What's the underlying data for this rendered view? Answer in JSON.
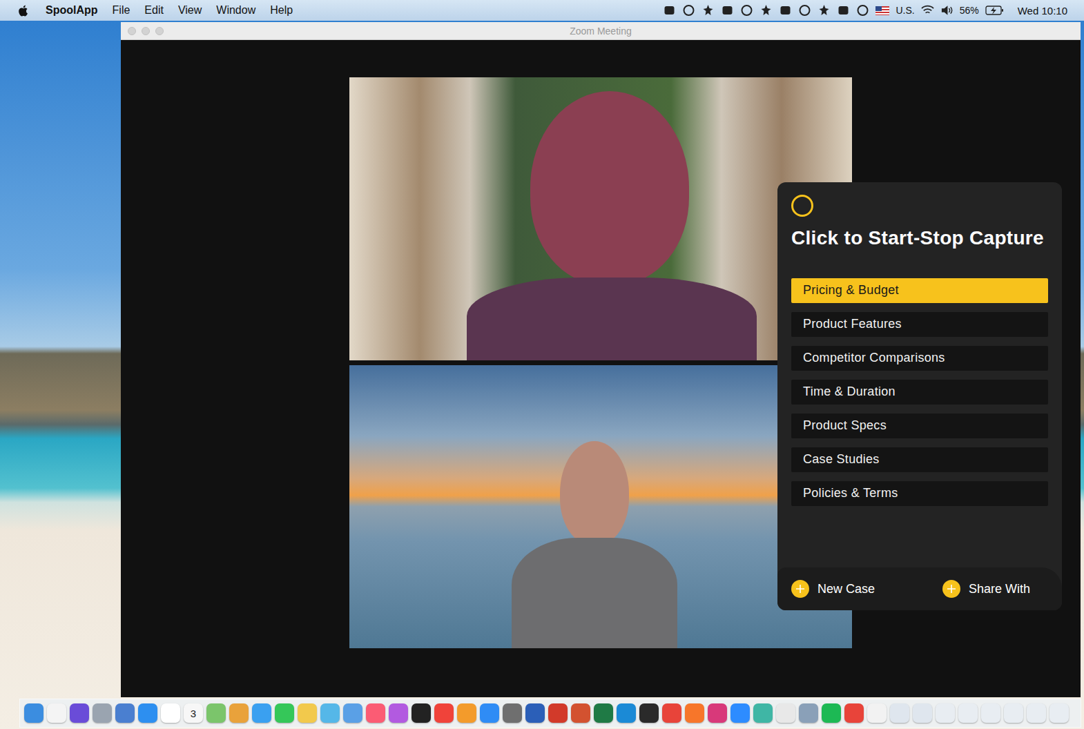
{
  "menubar": {
    "app": "SpoolApp",
    "menus": [
      "File",
      "Edit",
      "View",
      "Window",
      "Help"
    ],
    "input_source": "U.S.",
    "battery": "56%",
    "clock": "Wed 10:10"
  },
  "window": {
    "title": "Zoom Meeting"
  },
  "capture_panel": {
    "recording": false,
    "title": "Click to Start-Stop Capture",
    "categories": [
      {
        "label": "Pricing & Budget",
        "selected": true
      },
      {
        "label": "Product Features",
        "selected": false
      },
      {
        "label": "Competitor Comparisons",
        "selected": false
      },
      {
        "label": "Time & Duration",
        "selected": false
      },
      {
        "label": "Product Specs",
        "selected": false
      },
      {
        "label": "Case Studies",
        "selected": false
      },
      {
        "label": "Policies & Terms",
        "selected": false
      }
    ],
    "actions": [
      "New Case",
      "Share With"
    ]
  },
  "dock": {
    "calendar_date": "3"
  }
}
